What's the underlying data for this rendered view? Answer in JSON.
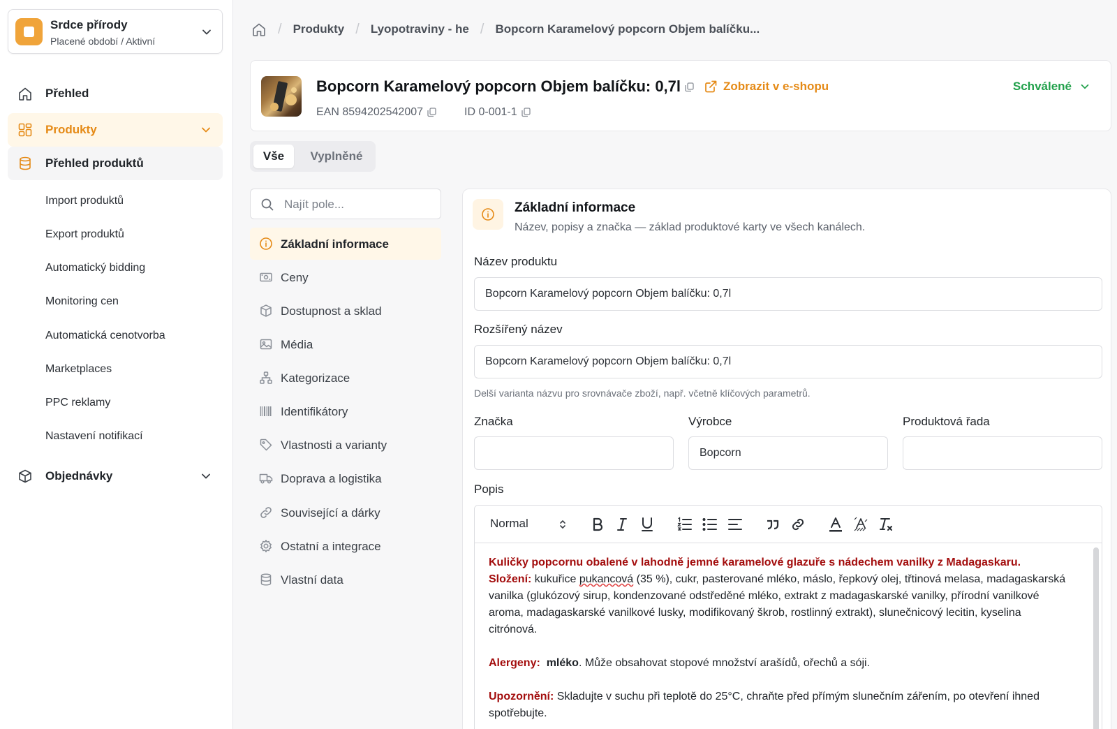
{
  "org": {
    "name": "Srdce přírody",
    "subtitle": "Placené období / Aktivní"
  },
  "sidebar": {
    "overview": "Přehled",
    "products": "Produkty",
    "products_overview": "Přehled produktů",
    "sub_items": [
      "Import produktů",
      "Export produktů",
      "Automatický bidding",
      "Monitoring cen",
      "Automatická cenotvorba",
      "Marketplaces",
      "PPC reklamy",
      "Nastavení notifikací"
    ],
    "orders": "Objednávky"
  },
  "breadcrumb": [
    "Produkty",
    "Lyopotraviny - he",
    "Bopcorn Karamelový popcorn Objem balíčku..."
  ],
  "product": {
    "title": "Bopcorn Karamelový popcorn Objem balíčku: 0,7l",
    "eshop_link": "Zobrazit v e-shopu",
    "ean": "EAN 8594202542007",
    "id": "ID 0-001-1",
    "status": "Schválené"
  },
  "tabs": {
    "all": "Vše",
    "filled": "Vyplněné"
  },
  "search": {
    "placeholder": "Najít pole..."
  },
  "sections": [
    {
      "label": "Základní informace",
      "icon": "info-icon"
    },
    {
      "label": "Ceny",
      "icon": "banknote-icon"
    },
    {
      "label": "Dostupnost a sklad",
      "icon": "box-icon"
    },
    {
      "label": "Média",
      "icon": "images-icon"
    },
    {
      "label": "Kategorizace",
      "icon": "hierarchy-icon"
    },
    {
      "label": "Identifikátory",
      "icon": "barcode-icon"
    },
    {
      "label": "Vlastnosti a varianty",
      "icon": "tag-icon"
    },
    {
      "label": "Doprava a logistika",
      "icon": "truck-icon"
    },
    {
      "label": "Související a dárky",
      "icon": "link-icon"
    },
    {
      "label": "Ostatní a integrace",
      "icon": "gear-icon"
    },
    {
      "label": "Vlastní data",
      "icon": "database-icon"
    }
  ],
  "panel": {
    "title": "Základní informace",
    "description": "Název, popisy a značka — základ produktové karty ve všech kanálech.",
    "name_label": "Název produktu",
    "name_value": "Bopcorn Karamelový popcorn Objem balíčku: 0,7l",
    "ext_label": "Rozšířený název",
    "ext_value": "Bopcorn Karamelový popcorn Objem balíčku: 0,7l",
    "ext_hint": "Delší varianta názvu pro srovnávače zboží, např. včetně klíčových parametrů.",
    "brand_label": "Značka",
    "brand_value": "",
    "maker_label": "Výrobce",
    "maker_value": "Bopcorn",
    "line_label": "Produktová řada",
    "line_value": "",
    "desc_label": "Popis",
    "format_select": "Normal"
  },
  "description": {
    "intro": "Kuličky popcornu obalené v lahodně jemné karamelové glazuře s nádechem vanilky z Madagaskaru.",
    "ingredients_label": "Složení:",
    "ingredients_a": " kukuřice ",
    "ingredients_b": "pukancová",
    "ingredients_c": " (35 %), cukr, pasterované mléko, máslo, řepkový olej, třtinová melasa, madagaskarská vanilka (glukózový sirup, kondenzované odstředěné mléko, extrakt z madagaskarské vanilky, přírodní vanilkové aroma, madagaskarské vanilkové lusky, modifikovaný škrob, rostlinný extrakt), slunečnicový lecitin, kyselina citrónová.",
    "allergens_label": "Alergeny:",
    "allergens_bold": "mléko",
    "allergens_text": ". Může obsahovat stopové množství arašídů, ořechů a sóji.",
    "warning_label": "Upozornění:",
    "warning_text": " Skladujte v suchu při teplotě do 25°C, chraňte před přímým slunečním zářením, po otevření ihned spotřebujte."
  },
  "colors": {
    "accent": "#e58a16",
    "success": "#20a04a",
    "emphasis": "#a30d0d"
  }
}
